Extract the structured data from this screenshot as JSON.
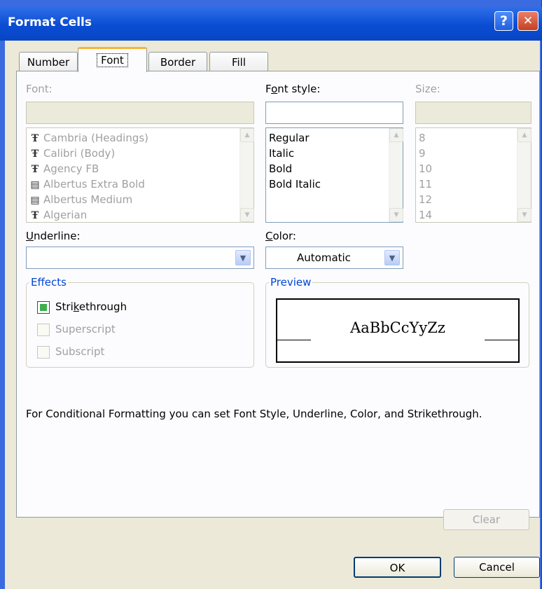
{
  "window": {
    "title": "Format Cells",
    "help_glyph": "?",
    "close_glyph": "✕"
  },
  "tabs": [
    {
      "label": "Number"
    },
    {
      "label": "Font"
    },
    {
      "label": "Border"
    },
    {
      "label": "Fill"
    }
  ],
  "font": {
    "label": "Font:",
    "value": "",
    "items": [
      {
        "name": "Cambria (Headings)",
        "icon": "truetype-icon"
      },
      {
        "name": "Calibri (Body)",
        "icon": "truetype-icon"
      },
      {
        "name": "Agency FB",
        "icon": "truetype-icon"
      },
      {
        "name": "Albertus Extra Bold",
        "icon": "printer-font-icon"
      },
      {
        "name": "Albertus Medium",
        "icon": "printer-font-icon"
      },
      {
        "name": "Algerian",
        "icon": "truetype-icon"
      }
    ]
  },
  "font_style": {
    "label_pre": "F",
    "label_u": "o",
    "label_post": "nt style:",
    "value": "",
    "items": [
      "Regular",
      "Italic",
      "Bold",
      "Bold Italic"
    ]
  },
  "size": {
    "label": "Size:",
    "value": "",
    "items": [
      "8",
      "9",
      "10",
      "11",
      "12",
      "14"
    ]
  },
  "underline": {
    "label_u": "U",
    "label_post": "nderline:",
    "value": ""
  },
  "color": {
    "label_u": "C",
    "label_post": "olor:",
    "value": "Automatic"
  },
  "effects": {
    "legend": "Effects",
    "strikethrough": {
      "pre": "Stri",
      "u": "k",
      "post": "ethrough",
      "checked": true
    },
    "superscript": {
      "label": "Superscript",
      "checked": false
    },
    "subscript": {
      "label": "Subscript",
      "checked": false
    }
  },
  "preview": {
    "legend": "Preview",
    "sample": "AaBbCcYyZz"
  },
  "info_text": "For Conditional Formatting you can set Font Style, Underline, Color, and Strikethrough.",
  "buttons": {
    "clear": "Clear",
    "ok": "OK",
    "cancel": "Cancel"
  },
  "colors": {
    "title_bar": "#0a4dd3",
    "accent": "#0046d5",
    "tab_highlight": "#f9b43a",
    "check_fill": "#3cb04a"
  }
}
